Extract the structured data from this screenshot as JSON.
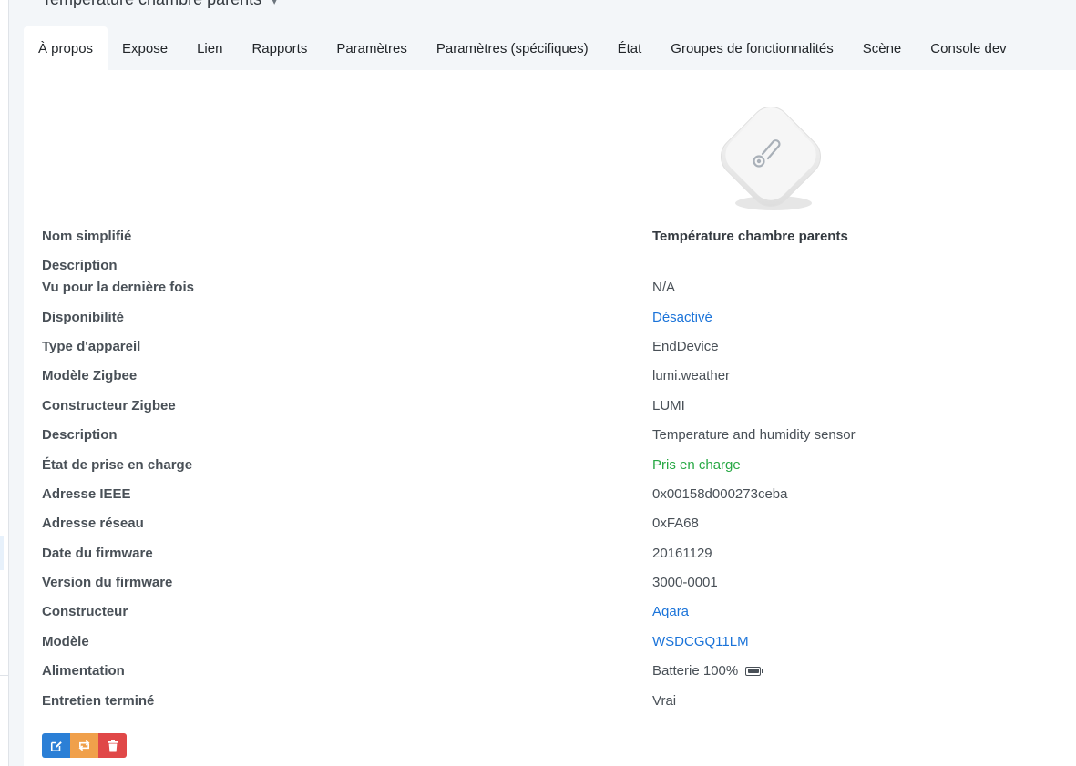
{
  "header": {
    "title": "Température chambre parents"
  },
  "tabs": [
    {
      "label": "À propos",
      "active": true
    },
    {
      "label": "Expose"
    },
    {
      "label": "Lien"
    },
    {
      "label": "Rapports"
    },
    {
      "label": "Paramètres"
    },
    {
      "label": "Paramètres (spécifiques)"
    },
    {
      "label": "État"
    },
    {
      "label": "Groupes de fonctionnalités"
    },
    {
      "label": "Scène"
    },
    {
      "label": "Console dev"
    }
  ],
  "device": {
    "image_icon": "thermometer-sensor",
    "rows": [
      {
        "label": "Nom simplifié",
        "value": "Température chambre parents",
        "style": "strong"
      },
      {
        "label": "Description",
        "value": ""
      },
      {
        "label": "Vu pour la dernière fois",
        "value": "N/A"
      },
      {
        "label": "Disponibilité",
        "value": "Désactivé",
        "style": "link"
      },
      {
        "label": "Type d'appareil",
        "value": "EndDevice"
      },
      {
        "label": "Modèle Zigbee",
        "value": "lumi.weather"
      },
      {
        "label": "Constructeur Zigbee",
        "value": "LUMI"
      },
      {
        "label": "Description",
        "value": "Temperature and humidity sensor"
      },
      {
        "label": "État de prise en charge",
        "value": "Pris en charge",
        "style": "ok"
      },
      {
        "label": "Adresse IEEE",
        "value": "0x00158d000273ceba"
      },
      {
        "label": "Adresse réseau",
        "value": "0xFA68"
      },
      {
        "label": "Date du firmware",
        "value": "20161129"
      },
      {
        "label": "Version du firmware",
        "value": "3000-0001"
      },
      {
        "label": "Constructeur",
        "value": "Aqara",
        "style": "link"
      },
      {
        "label": "Modèle",
        "value": "WSDCGQ11LM",
        "style": "link"
      },
      {
        "label": "Alimentation",
        "value": "Batterie 100%",
        "icon": "battery-full-icon"
      },
      {
        "label": "Entretien terminé",
        "value": "Vrai"
      }
    ]
  },
  "actions": [
    {
      "icon": "edit-icon",
      "color": "#2b7fd6"
    },
    {
      "icon": "swap-icon",
      "color": "#f0a04b"
    },
    {
      "icon": "trash-icon",
      "color": "#e04848"
    }
  ],
  "colors": {
    "link": "#1a73d9",
    "ok": "#27a844",
    "background": "#f3f6f9"
  }
}
